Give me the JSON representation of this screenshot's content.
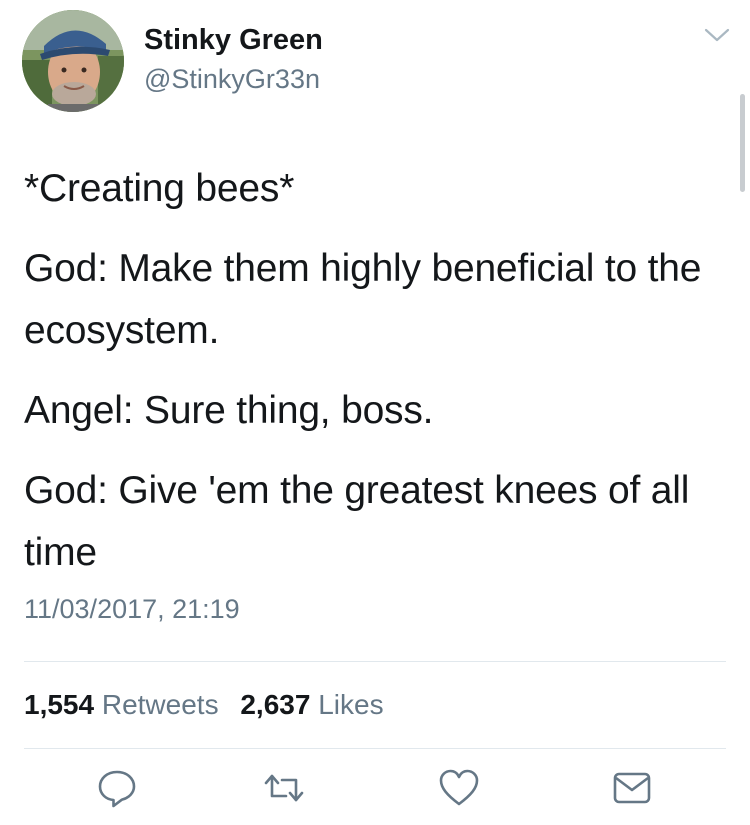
{
  "author": {
    "name": "Stinky Green",
    "handle": "@StinkyGr33n"
  },
  "tweet": {
    "paragraphs": [
      "*Creating bees*",
      "God: Make them highly beneficial to the ecosystem.",
      "Angel: Sure thing, boss.",
      "God: Give 'em the greatest knees of all time"
    ],
    "timestamp": "11/03/2017, 21:19"
  },
  "stats": {
    "retweets_count": "1,554",
    "retweets_label": "Retweets",
    "likes_count": "2,637",
    "likes_label": "Likes"
  },
  "icons": {
    "menu": "chevron-down-icon",
    "reply": "reply-icon",
    "retweet": "retweet-icon",
    "like": "heart-icon",
    "message": "envelope-icon"
  },
  "colors": {
    "text": "#14171a",
    "secondary": "#657786",
    "divider": "#e1e8ed",
    "icon": "#657786"
  }
}
